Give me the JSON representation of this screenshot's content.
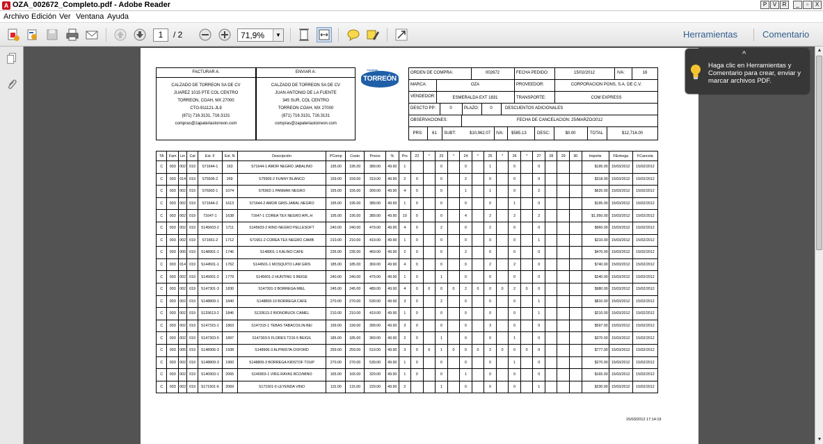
{
  "window": {
    "title": "OZA_002672_Completo.pdf - Adobe Reader",
    "buttons": [
      "P",
      "V",
      "R",
      "_",
      "▫",
      "X"
    ]
  },
  "menu": [
    "Archivo",
    "Edición",
    "Ver",
    "Ventana",
    "Ayuda"
  ],
  "toolbar": {
    "page_current": "1",
    "page_total": "/ 2",
    "zoom": "71,9%",
    "tools_link": "Herramientas",
    "comment_link": "Comentario"
  },
  "tooltip": {
    "text": "Haga clic en Herramientas y Comentario para crear, enviar y marcar archivos PDF."
  },
  "doc": {
    "facturar_title": "FACTURAR A:",
    "facturar_lines": [
      "CALZADO DE TORREON SA DE CV",
      "JUAREZ 1015 PTE COL CENTRO",
      "TORREON, COAH, MX 27000",
      "CTO-911121-JL9",
      "(871) 716.3131, 716.3131",
      "compras@zapateriastorreon.com"
    ],
    "enviar_title": "ENVIAR A:",
    "enviar_lines": [
      "CALZADO DE TORREON SA DE CV",
      "JUAN ANTONIO DE LA FUENTE",
      "345 SUR, COL CENTRO",
      "TORREON COAH, MX 27000",
      "(871) 716.3131, 716.3131",
      "compras@zapateriastorreon.com"
    ],
    "logo_small": "Zapaterías",
    "logo": "TORREÓN",
    "orden_label": "ORDEN DE COMPRA:",
    "orden_value": "002672",
    "fecha_label": "FECHA PEDIDO:",
    "fecha_value": "15/02/2012",
    "iva_label": "IVA:",
    "iva_value": "16",
    "marca_label": "MARCA:",
    "marca_value": "OZA",
    "proveedor_label": "PROVEEDOR:",
    "proveedor_value": "CORPORACION PONS, S.A. DE C.V.",
    "vendedor_label": "VENDEDOR:",
    "vendedor_value": "ESMERALDA EXT 1831",
    "transporte_label": "TRANSPORTE:",
    "transporte_value": "COM EXPRESS",
    "descto_label": "DESCTO PP:",
    "descto_value": "0",
    "plazo_label": "PLAZO:",
    "plazo_value": "0",
    "descuentos_label": "DESCUENTOS ADICIONALES",
    "obs_label": "OBSERVACIONES:",
    "cancel_text": "FECHA DE CANCELACION: 25/MARZO/2012",
    "prs_label": "PRS:",
    "prs_value": "61",
    "subt_label": "SUBT:",
    "subt_value": "$10,962.07",
    "iva2_label": "IVA:",
    "iva2_value": "$585.13",
    "desc_label": "DESC:",
    "desc_value": "$0.00",
    "total_label": "TOTAL",
    "total_value": "$12,716.00",
    "stamp": "15/03/2012 17:14:19"
  },
  "table": {
    "headers": [
      "TA",
      "Fam",
      "Lin",
      "Cat",
      "Est. F",
      "Est. N",
      "Descripción",
      "PComp",
      "Costo",
      "Precio",
      "%",
      "Prs",
      "22",
      "*",
      "23",
      "*",
      "24",
      "*",
      "25",
      "*",
      "26",
      "*",
      "27",
      "28",
      "29",
      "30",
      "Importe",
      "FEntrega",
      "FCancela"
    ],
    "rows": [
      [
        "C",
        "003",
        "002",
        "019",
        "S71644-1",
        "163",
        "S71644-1 AMOR NEGRO JABALINO",
        "195.00",
        "195.00",
        "389.00",
        "49.90",
        "1",
        "",
        "",
        "0",
        "",
        "0",
        "",
        "1",
        "",
        "0",
        "",
        "0",
        "",
        "",
        "",
        "$195.00",
        "15/03/2012",
        "15/02/2012"
      ],
      [
        "C",
        "003",
        "014",
        "019",
        "S75505-2",
        "269",
        "S75505-2 FUNNY BLANCO",
        "159.00",
        "159.00",
        "319.00",
        "49.90",
        "2",
        "0",
        "",
        "0",
        "",
        "2",
        "",
        "0",
        "",
        "0",
        "",
        "0",
        "",
        "",
        "",
        "$318.00",
        "15/03/2012",
        "15/02/2012"
      ],
      [
        "C",
        "003",
        "002",
        "019",
        "S76902-1",
        "1074",
        "S76902-1 PANMAK NEGRO",
        "155.00",
        "155.00",
        "309.00",
        "49.90",
        "4",
        "0",
        "",
        "0",
        "",
        "1",
        "",
        "1",
        "",
        "0",
        "",
        "2",
        "",
        "",
        "",
        "$620.00",
        "15/03/2012",
        "15/02/2012"
      ],
      [
        "C",
        "003",
        "002",
        "019",
        "S71644-2",
        "1613",
        "S71644-2 AMOR GRIS-JABAL.NEGRO",
        "195.00",
        "195.00",
        "389.00",
        "49.90",
        "1",
        "0",
        "",
        "0",
        "",
        "0",
        "",
        "0",
        "",
        "1",
        "",
        "0",
        "",
        "",
        "",
        "$195.00",
        "15/03/2012",
        "15/02/2012"
      ],
      [
        "C",
        "003",
        "002",
        "019",
        "71647-1",
        "1638",
        "71647-1 COREA TEX NEGRO APL.H",
        "195.00",
        "195.00",
        "389.00",
        "49.90",
        "10",
        "0",
        "",
        "0",
        "",
        "4",
        "",
        "2",
        "",
        "2",
        "",
        "2",
        "",
        "",
        "",
        "$1,950.00",
        "15/03/2012",
        "15/02/2012"
      ],
      [
        "C",
        "003",
        "002",
        "019",
        "S145603-2",
        "1711",
        "S145603-2 RINO NEGRO PELLESOFT",
        "240.00",
        "240.00",
        "479.00",
        "49.90",
        "4",
        "0",
        "",
        "2",
        "",
        "0",
        "",
        "2",
        "",
        "0",
        "",
        "0",
        "",
        "",
        "",
        "$960.00",
        "15/03/2012",
        "15/02/2012"
      ],
      [
        "C",
        "003",
        "002",
        "019",
        "S71661-2",
        "1712",
        "S71661-2 COREA TEX NEGRO CAMB",
        "210.00",
        "210.00",
        "419.00",
        "49.90",
        "1",
        "0",
        "",
        "0",
        "",
        "0",
        "",
        "0",
        "",
        "0",
        "",
        "1",
        "",
        "",
        "",
        "$210.00",
        "15/03/2012",
        "15/02/2012"
      ],
      [
        "C",
        "003",
        "005",
        "019",
        "S148901-1",
        "1746",
        "S148901-1 KALINO CAFE",
        "235.00",
        "235.00",
        "469.00",
        "49.90",
        "2",
        "0",
        "",
        "0",
        "",
        "2",
        "",
        "0",
        "",
        "0",
        "",
        "0",
        "",
        "",
        "",
        "$470.00",
        "15/03/2012",
        "15/02/2012"
      ],
      [
        "C",
        "003",
        "014",
        "019",
        "S144501-1",
        "1762",
        "S144501-1 MOSQUITO LAM GRIS",
        "185.00",
        "185.00",
        "369.00",
        "49.90",
        "4",
        "0",
        "",
        "0",
        "",
        "0",
        "",
        "2",
        "",
        "2",
        "",
        "0",
        "",
        "",
        "",
        "$740.00",
        "15/03/2012",
        "15/02/2012"
      ],
      [
        "C",
        "003",
        "002",
        "019",
        "S145601-2",
        "1779",
        "S145601-2 HUNTING S BEIGE",
        "240.00",
        "240.00",
        "479.00",
        "49.90",
        "1",
        "0",
        "",
        "1",
        "",
        "0",
        "",
        "0",
        "",
        "0",
        "",
        "0",
        "",
        "",
        "",
        "$240.00",
        "15/03/2012",
        "15/02/2012"
      ],
      [
        "C",
        "003",
        "002",
        "019",
        "S147301-3",
        "1830",
        "S147301-3 BORREGA MIEL",
        "245.00",
        "245.00",
        "489.00",
        "49.90",
        "4",
        "0",
        "0",
        "0",
        "0",
        "2",
        "0",
        "0",
        "0",
        "2",
        "0",
        "0",
        "",
        "",
        "",
        "$980.00",
        "15/03/2012",
        "15/02/2012"
      ],
      [
        "C",
        "003",
        "002",
        "019",
        "S148809-1",
        "1840",
        "S148809-10 BORREGA CAFE",
        "270.00",
        "270.00",
        "539.00",
        "49.90",
        "3",
        "0",
        "",
        "2",
        "",
        "0",
        "",
        "0",
        "",
        "0",
        "",
        "1",
        "",
        "",
        "",
        "$810.00",
        "15/03/2012",
        "15/02/2012"
      ],
      [
        "C",
        "003",
        "002",
        "019",
        "S133613-2",
        "1846",
        "S133613-2 BIONOBUCK CAMEL",
        "210.00",
        "210.00",
        "419.00",
        "49.90",
        "1",
        "0",
        "",
        "0",
        "",
        "0",
        "",
        "0",
        "",
        "0",
        "",
        "1",
        "",
        "",
        "",
        "$210.00",
        "15/03/2012",
        "15/02/2012"
      ],
      [
        "C",
        "003",
        "002",
        "019",
        "S147315-1",
        "1863",
        "S147315-1 TEBAS TABACO/LIN-BEI",
        "199.00",
        "199.00",
        "399.00",
        "49.90",
        "3",
        "0",
        "",
        "0",
        "",
        "0",
        "",
        "3",
        "",
        "0",
        "",
        "0",
        "",
        "",
        "",
        "$597.00",
        "15/03/2012",
        "15/02/2012"
      ],
      [
        "C",
        "003",
        "002",
        "019",
        "S147303-5",
        "1897",
        "S147303-5 FLORES T216-5 BEIGIL",
        "185.00",
        "185.00",
        "369.00",
        "49.90",
        "2",
        "0",
        "",
        "1",
        "",
        "0",
        "",
        "0",
        "",
        "1",
        "",
        "0",
        "",
        "",
        "",
        "$370.00",
        "15/03/2012",
        "15/02/2012"
      ],
      [
        "C",
        "003",
        "005",
        "019",
        "S148906-3",
        "1938",
        "S148906-3 ALPINISTA OXFORD",
        "259.00",
        "259.00",
        "519.00",
        "49.90",
        "3",
        "0",
        "0",
        "1",
        "0",
        "0",
        "0",
        "2",
        "0",
        "0",
        "0",
        "0",
        "",
        "",
        "",
        "$777.00",
        "15/03/2012",
        "15/02/2012"
      ],
      [
        "C",
        "003",
        "002",
        "019",
        "S148809-3",
        "1960",
        "S148809-3 BORREGA KRISTOF TOUP",
        "270.00",
        "270.00",
        "539.00",
        "49.90",
        "1",
        "0",
        "",
        "0",
        "",
        "0",
        "",
        "0",
        "",
        "1",
        "",
        "0",
        "",
        "",
        "",
        "$270.00",
        "15/03/2012",
        "15/02/2012"
      ],
      [
        "C",
        "003",
        "002",
        "019",
        "S140903-1",
        "2065",
        "S140903-1 VIRG RAYAS BCO/MINO",
        "165.00",
        "165.00",
        "329.00",
        "49.90",
        "1",
        "0",
        "",
        "0",
        "",
        "1",
        "",
        "0",
        "",
        "0",
        "",
        "0",
        "",
        "",
        "",
        "$165.00",
        "15/03/2012",
        "15/02/2012"
      ],
      [
        "C",
        "003",
        "002",
        "019",
        "S171501-6",
        "2069",
        "S171501-6 LEYENDA VINO",
        "115.00",
        "115.00",
        "229.00",
        "49.90",
        "2",
        "",
        "",
        "1",
        "",
        "0",
        "",
        "0",
        "",
        "0",
        "",
        "1",
        "",
        "",
        "",
        "$230.00",
        "15/03/2012",
        "15/02/2012"
      ]
    ]
  }
}
